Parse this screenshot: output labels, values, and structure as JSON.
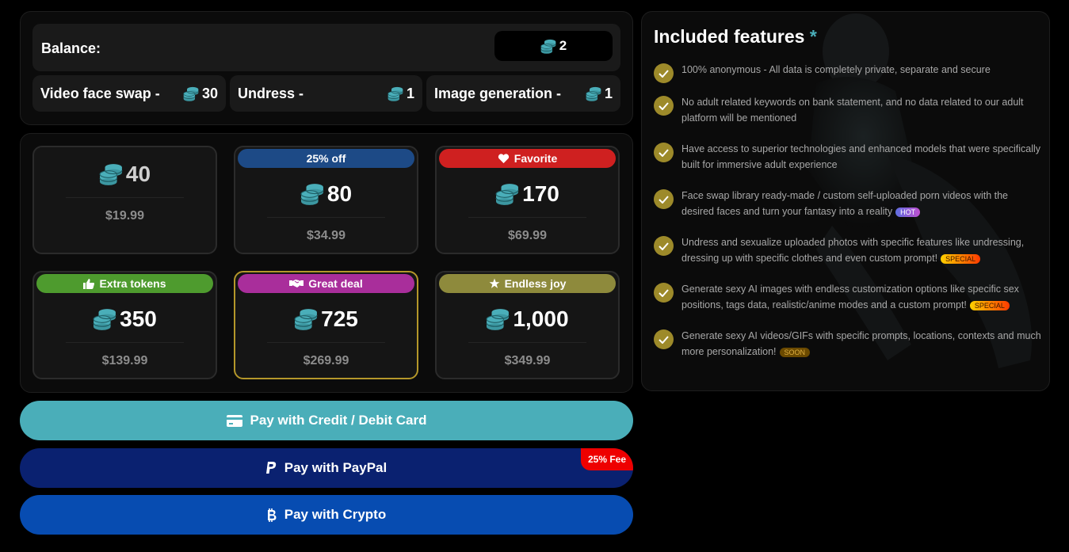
{
  "balance": {
    "label": "Balance:",
    "value": "2"
  },
  "costs": [
    {
      "label": "Video face swap -",
      "value": "30"
    },
    {
      "label": "Undress -",
      "value": "1"
    },
    {
      "label": "Image generation -",
      "value": "1"
    }
  ],
  "packages": [
    {
      "badge": "",
      "tokens": "40",
      "price": "$19.99"
    },
    {
      "badge": "25% off",
      "tokens": "80",
      "price": "$34.99",
      "badge_color": "#1d4a86"
    },
    {
      "badge": "Favorite",
      "tokens": "170",
      "price": "$69.99",
      "badge_color": "#cf2020"
    },
    {
      "badge": "Extra tokens",
      "tokens": "350",
      "price": "$139.99",
      "badge_color": "#4e9b2e"
    },
    {
      "badge": "Great deal",
      "tokens": "725",
      "price": "$269.99",
      "badge_color": "#a92e9b"
    },
    {
      "badge": "Endless joy",
      "tokens": "1,000",
      "price": "$349.99",
      "badge_color": "#8e8a3c"
    }
  ],
  "payment": {
    "card_label": "Pay with Credit / Debit Card",
    "paypal_label": "Pay with PayPal",
    "paypal_fee": "25% Fee",
    "crypto_label": "Pay with Crypto"
  },
  "features": {
    "title": "Included features",
    "title_mark": "*",
    "items": [
      {
        "text": "100% anonymous - All data is completely private, separate and secure",
        "tag": ""
      },
      {
        "text": "No adult related keywords on bank statement, and no data related to our adult platform will be mentioned",
        "tag": ""
      },
      {
        "text": "Have access to superior technologies and enhanced models that were specifically built for immersive adult experience",
        "tag": ""
      },
      {
        "text": "Face swap library ready-made / custom self-uploaded porn videos with the desired faces and turn your fantasy into a reality",
        "tag": "HOT"
      },
      {
        "text": "Undress and sexualize uploaded photos with specific features like undressing, dressing up with specific clothes and even custom prompt!",
        "tag": "SPECIAL"
      },
      {
        "text": "Generate sexy AI images with endless customization options like specific sex positions, tags data, realistic/anime modes and a custom prompt!",
        "tag": "SPECIAL"
      },
      {
        "text": "Generate sexy AI videos/GIFs with specific prompts, locations, contexts and much more personalization!",
        "tag": "SOON"
      }
    ]
  },
  "colors": {
    "accent": "#4aaeb9",
    "gold": "#b4972a",
    "paypal": "#0a2170",
    "crypto": "#074cb1",
    "fee": "#ee0000"
  },
  "icons": [
    "coins-icon",
    "heart-icon",
    "thumbs-up-icon",
    "handshake-icon",
    "star-icon",
    "credit-card-icon",
    "paypal-icon",
    "bitcoin-icon",
    "check-icon"
  ]
}
